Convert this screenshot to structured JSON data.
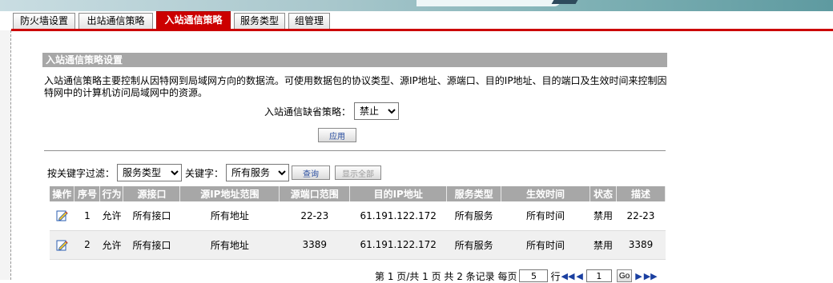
{
  "tabs": [
    {
      "label": "防火墙设置",
      "active": false
    },
    {
      "label": "出站通信策略",
      "active": false
    },
    {
      "label": "入站通信策略",
      "active": true
    },
    {
      "label": "服务类型",
      "active": false
    },
    {
      "label": "组管理",
      "active": false
    }
  ],
  "section": {
    "title": "入站通信策略设置",
    "description": "入站通信策略主要控制从因特网到局域网方向的数据流。可使用数据包的协议类型、源IP地址、源端口、目的IP地址、目的端口及生效时间来控制因特网中的计算机访问局域网中的资源。"
  },
  "default_policy": {
    "label": "入站通信缺省策略：",
    "value": "禁止",
    "apply_label": "应用"
  },
  "filter": {
    "label": "按关键字过滤：",
    "type_value": "服务类型",
    "keyword_label": "关键字：",
    "keyword_value": "所有服务",
    "query_label": "查询",
    "show_all_label": "显示全部"
  },
  "table": {
    "headers": [
      "操作",
      "序号",
      "行为",
      "源接口",
      "源IP地址范围",
      "源端口范围",
      "目的IP地址",
      "服务类型",
      "生效时间",
      "状态",
      "描述"
    ],
    "rows": [
      [
        "",
        "1",
        "允许",
        "所有接口",
        "所有地址",
        "22-23",
        "61.191.122.172",
        "所有服务",
        "所有时间",
        "禁用",
        "22-23"
      ],
      [
        "",
        "2",
        "允许",
        "所有接口",
        "所有地址",
        "3389",
        "61.191.122.172",
        "所有服务",
        "所有时间",
        "禁用",
        "3389"
      ]
    ]
  },
  "pager": {
    "summary": "第 1 页/共 1 页 共 2 条记录 每页",
    "per_page": "5",
    "per_page_unit": "行",
    "page_input": "1",
    "go_label": "Go"
  },
  "colors": {
    "accent_red": "#cc0000",
    "header_gray": "#a7a7a7",
    "link_blue": "#1a3fa0"
  }
}
